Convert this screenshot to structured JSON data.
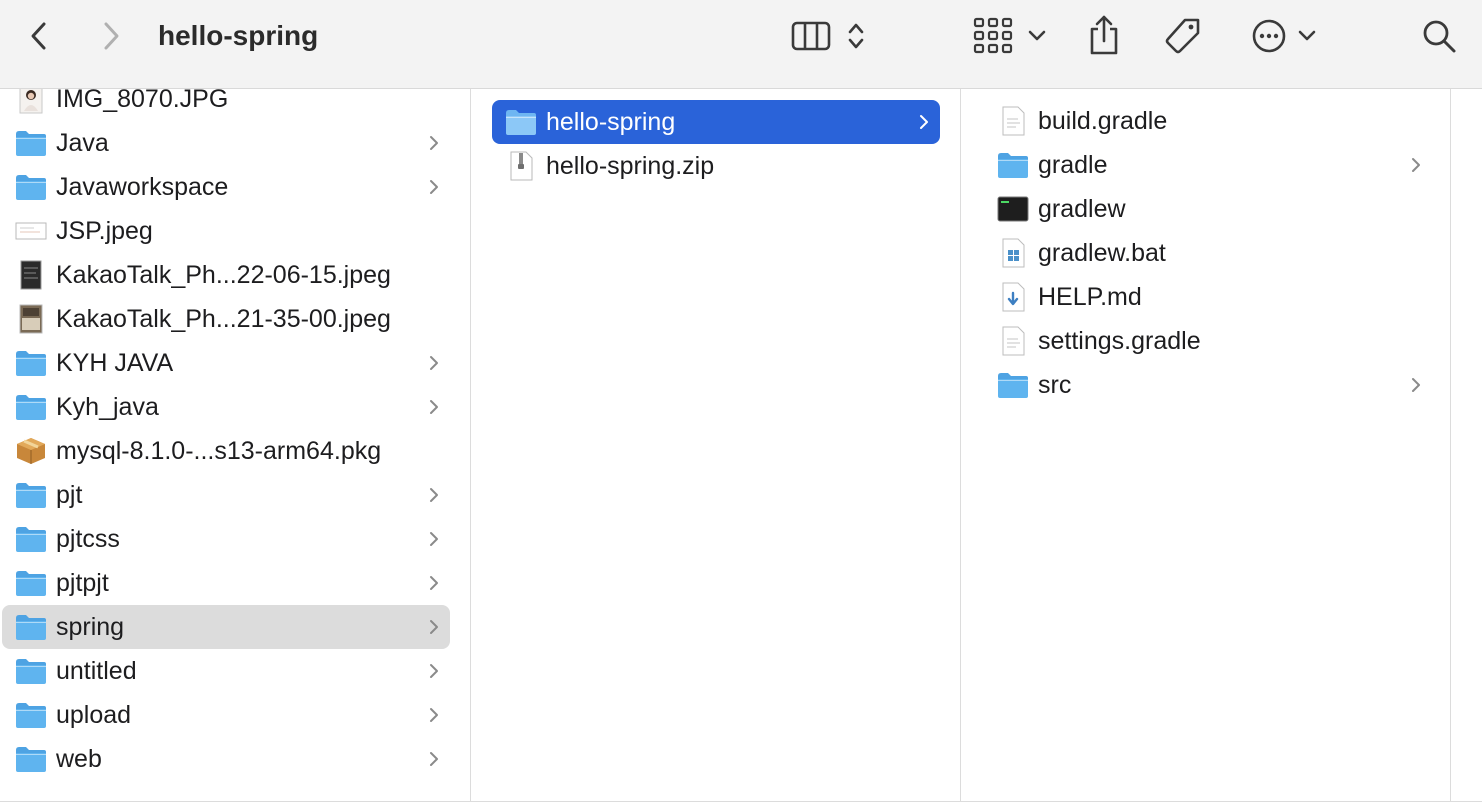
{
  "window": {
    "title": "hello-spring"
  },
  "toolbar": {
    "icons": [
      "back-icon",
      "forward-icon",
      "column-view-icon",
      "sort-updown-icon",
      "group-grid-icon",
      "chevron-down-icon",
      "share-icon",
      "tag-icon",
      "more-icon",
      "chevron-down-icon",
      "search-icon"
    ]
  },
  "columns": [
    {
      "items": [
        {
          "name": "IMG_8070.JPG",
          "kind": "image-photo",
          "folder": false
        },
        {
          "name": "Java",
          "kind": "folder",
          "folder": true
        },
        {
          "name": "Javaworkspace",
          "kind": "folder",
          "folder": true
        },
        {
          "name": "JSP.jpeg",
          "kind": "image-doc",
          "folder": false
        },
        {
          "name": "KakaoTalk_Ph...22-06-15.jpeg",
          "kind": "image-dark",
          "folder": false
        },
        {
          "name": "KakaoTalk_Ph...21-35-00.jpeg",
          "kind": "image-photo2",
          "folder": false
        },
        {
          "name": "KYH JAVA",
          "kind": "folder",
          "folder": true
        },
        {
          "name": "Kyh_java",
          "kind": "folder",
          "folder": true
        },
        {
          "name": "mysql-8.1.0-...s13-arm64.pkg",
          "kind": "package",
          "folder": false
        },
        {
          "name": "pjt",
          "kind": "folder",
          "folder": true
        },
        {
          "name": "pjtcss",
          "kind": "folder",
          "folder": true
        },
        {
          "name": "pjtpjt",
          "kind": "folder",
          "folder": true
        },
        {
          "name": "spring",
          "kind": "folder",
          "folder": true,
          "selected": "grey"
        },
        {
          "name": "untitled",
          "kind": "folder",
          "folder": true
        },
        {
          "name": "upload",
          "kind": "folder",
          "folder": true
        },
        {
          "name": "web",
          "kind": "folder",
          "folder": true
        }
      ]
    },
    {
      "items": [
        {
          "name": "hello-spring",
          "kind": "folder",
          "folder": true,
          "selected": "blue"
        },
        {
          "name": "hello-spring.zip",
          "kind": "zip",
          "folder": false
        }
      ]
    },
    {
      "items": [
        {
          "name": "build.gradle",
          "kind": "text-doc",
          "folder": false
        },
        {
          "name": "gradle",
          "kind": "folder",
          "folder": true
        },
        {
          "name": "gradlew",
          "kind": "terminal",
          "folder": false
        },
        {
          "name": "gradlew.bat",
          "kind": "bat",
          "folder": false
        },
        {
          "name": "HELP.md",
          "kind": "markdown",
          "folder": false
        },
        {
          "name": "settings.gradle",
          "kind": "text-doc",
          "folder": false
        },
        {
          "name": "src",
          "kind": "folder",
          "folder": true
        }
      ]
    }
  ],
  "colors": {
    "selection_blue": "#2a63d9",
    "selection_grey": "#dcdcdc",
    "folder_blue": "#5fb4ef"
  }
}
